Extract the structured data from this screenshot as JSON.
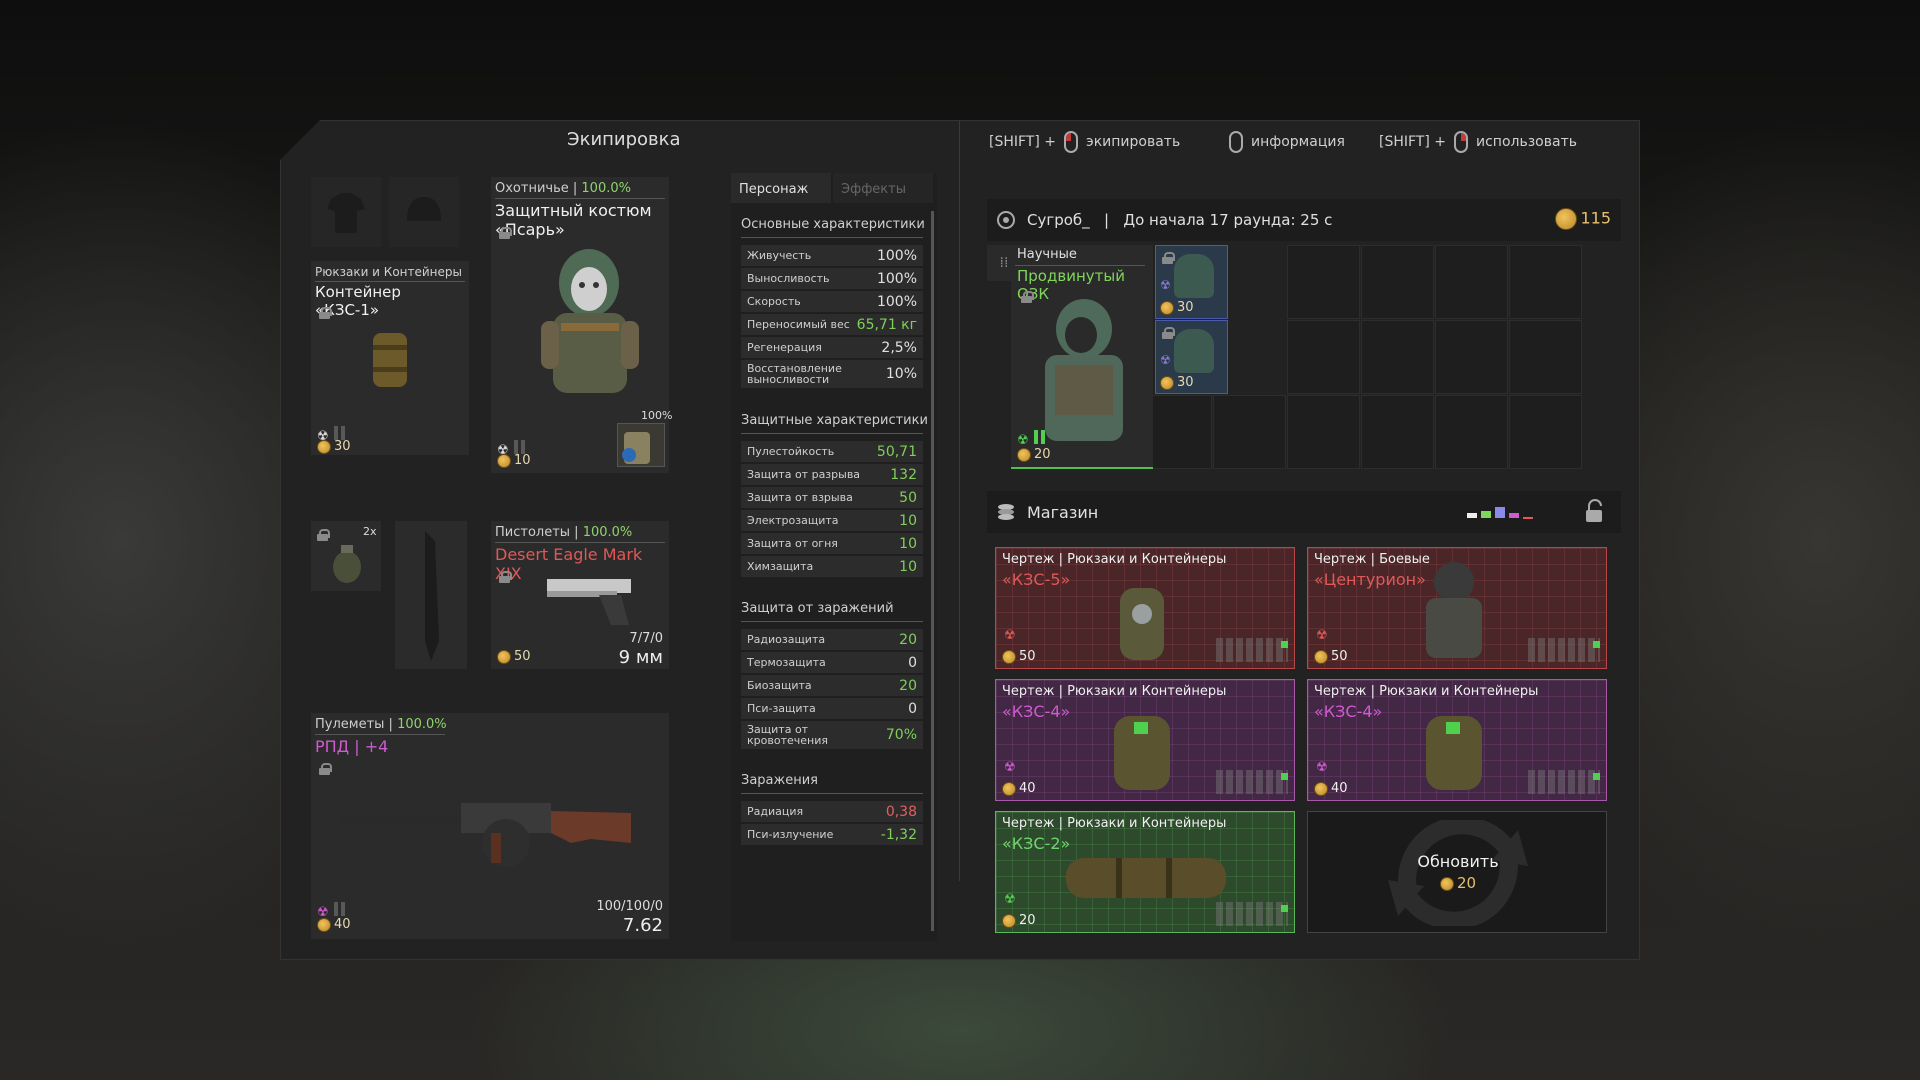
{
  "equipment": {
    "title": "Экипировка",
    "container": {
      "category": "Рюкзаки и Контейнеры",
      "name": "Контейнер «КЗС-1»",
      "price": "30"
    },
    "armor": {
      "category": "Охотничье",
      "condition": "100.0%",
      "name": "Защитный костюм «Псарь»",
      "price": "10",
      "extra_pct": "100%"
    },
    "grenade": {
      "count": "2x"
    },
    "pistol": {
      "category": "Пистолеты",
      "condition": "100.0%",
      "name": "Desert Eagle Mark XIX",
      "price": "50",
      "ammo": "7/7/0",
      "caliber": "9 мм"
    },
    "mg": {
      "category": "Пулеметы",
      "condition": "100.0%",
      "name": "РПД",
      "upgrade": "+4",
      "price": "40",
      "ammo": "100/100/0",
      "caliber": "7.62"
    }
  },
  "stats": {
    "tabs": [
      "Персонаж",
      "Эффекты"
    ],
    "sections": [
      {
        "title": "Основные характеристики",
        "rows": [
          {
            "label": "Живучесть",
            "value": "100%"
          },
          {
            "label": "Выносливость",
            "value": "100%"
          },
          {
            "label": "Скорость",
            "value": "100%"
          },
          {
            "label": "Переносимый вес",
            "value": "65,71 кг"
          },
          {
            "label": "Регенерация",
            "value": "2,5%"
          },
          {
            "label": "Восстановление выносливости",
            "value": "10%"
          }
        ]
      },
      {
        "title": "Защитные характеристики",
        "rows": [
          {
            "label": "Пулестойкость",
            "value": "50,71"
          },
          {
            "label": "Защита от разрыва",
            "value": "132"
          },
          {
            "label": "Защита от взрыва",
            "value": "50"
          },
          {
            "label": "Электрозащита",
            "value": "10"
          },
          {
            "label": "Защита от огня",
            "value": "10"
          },
          {
            "label": "Химзащита",
            "value": "10"
          }
        ]
      },
      {
        "title": "Защита от заражений",
        "rows": [
          {
            "label": "Радиозащита",
            "value": "20"
          },
          {
            "label": "Термозащита",
            "value": "0"
          },
          {
            "label": "Биозащита",
            "value": "20"
          },
          {
            "label": "Пси-защита",
            "value": "0"
          },
          {
            "label": "Защита от кровотечения",
            "value": "70%"
          }
        ]
      },
      {
        "title": "Заражения",
        "rows": [
          {
            "label": "Радиация",
            "value": "0,38"
          },
          {
            "label": "Пси-излучение",
            "value": "-1,32"
          }
        ]
      }
    ]
  },
  "hints": {
    "shift": "[SHIFT] +",
    "equip": "экипировать",
    "info": "информация",
    "use": "использовать"
  },
  "header": {
    "player": "Сугроб_",
    "separator": "|",
    "round": "До начала 17 раунда: 25 с",
    "money": "115"
  },
  "stash": {
    "item_category": "Научные",
    "item_name": "Продвинутый ОЗК",
    "item_price": "20",
    "small_price_1": "30",
    "small_price_2": "30"
  },
  "shop": {
    "title": "Магазин",
    "cards": [
      {
        "category": "Чертеж | Рюкзаки и Контейнеры",
        "name": "«КЗС-5»",
        "price": "50"
      },
      {
        "category": "Чертеж | Боевые",
        "name": "«Центурион»",
        "price": "50"
      },
      {
        "category": "Чертеж | Рюкзаки и Контейнеры",
        "name": "«КЗС-4»",
        "price": "40"
      },
      {
        "category": "Чертеж | Рюкзаки и Контейнеры",
        "name": "«КЗС-4»",
        "price": "40"
      },
      {
        "category": "Чертеж | Рюкзаки и Контейнеры",
        "name": "«КЗС-2»",
        "price": "20"
      }
    ],
    "refresh_label": "Обновить",
    "refresh_price": "20"
  }
}
